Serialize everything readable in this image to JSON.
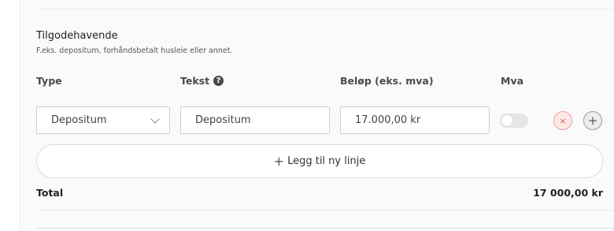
{
  "section": {
    "title": "Tilgodehavende",
    "subtitle": "F.eks. depositum, forhåndsbetalt husleie eller annet."
  },
  "columns": {
    "type": "Type",
    "text": "Tekst",
    "amount": "Beløp (eks. mva)",
    "vat": "Mva"
  },
  "row": {
    "type_value": "Depositum",
    "text_value": "Depositum",
    "amount_value": "17.000,00 kr",
    "vat_enabled": false,
    "remove_icon": "×",
    "add_icon": "+"
  },
  "help_icon": "?",
  "add_line": {
    "icon": "+",
    "label": "Legg til ny linje"
  },
  "total": {
    "label": "Total",
    "value": "17 000,00 kr"
  },
  "colors": {
    "panel_bg": "#fafafa",
    "remove_accent": "#d25757"
  }
}
